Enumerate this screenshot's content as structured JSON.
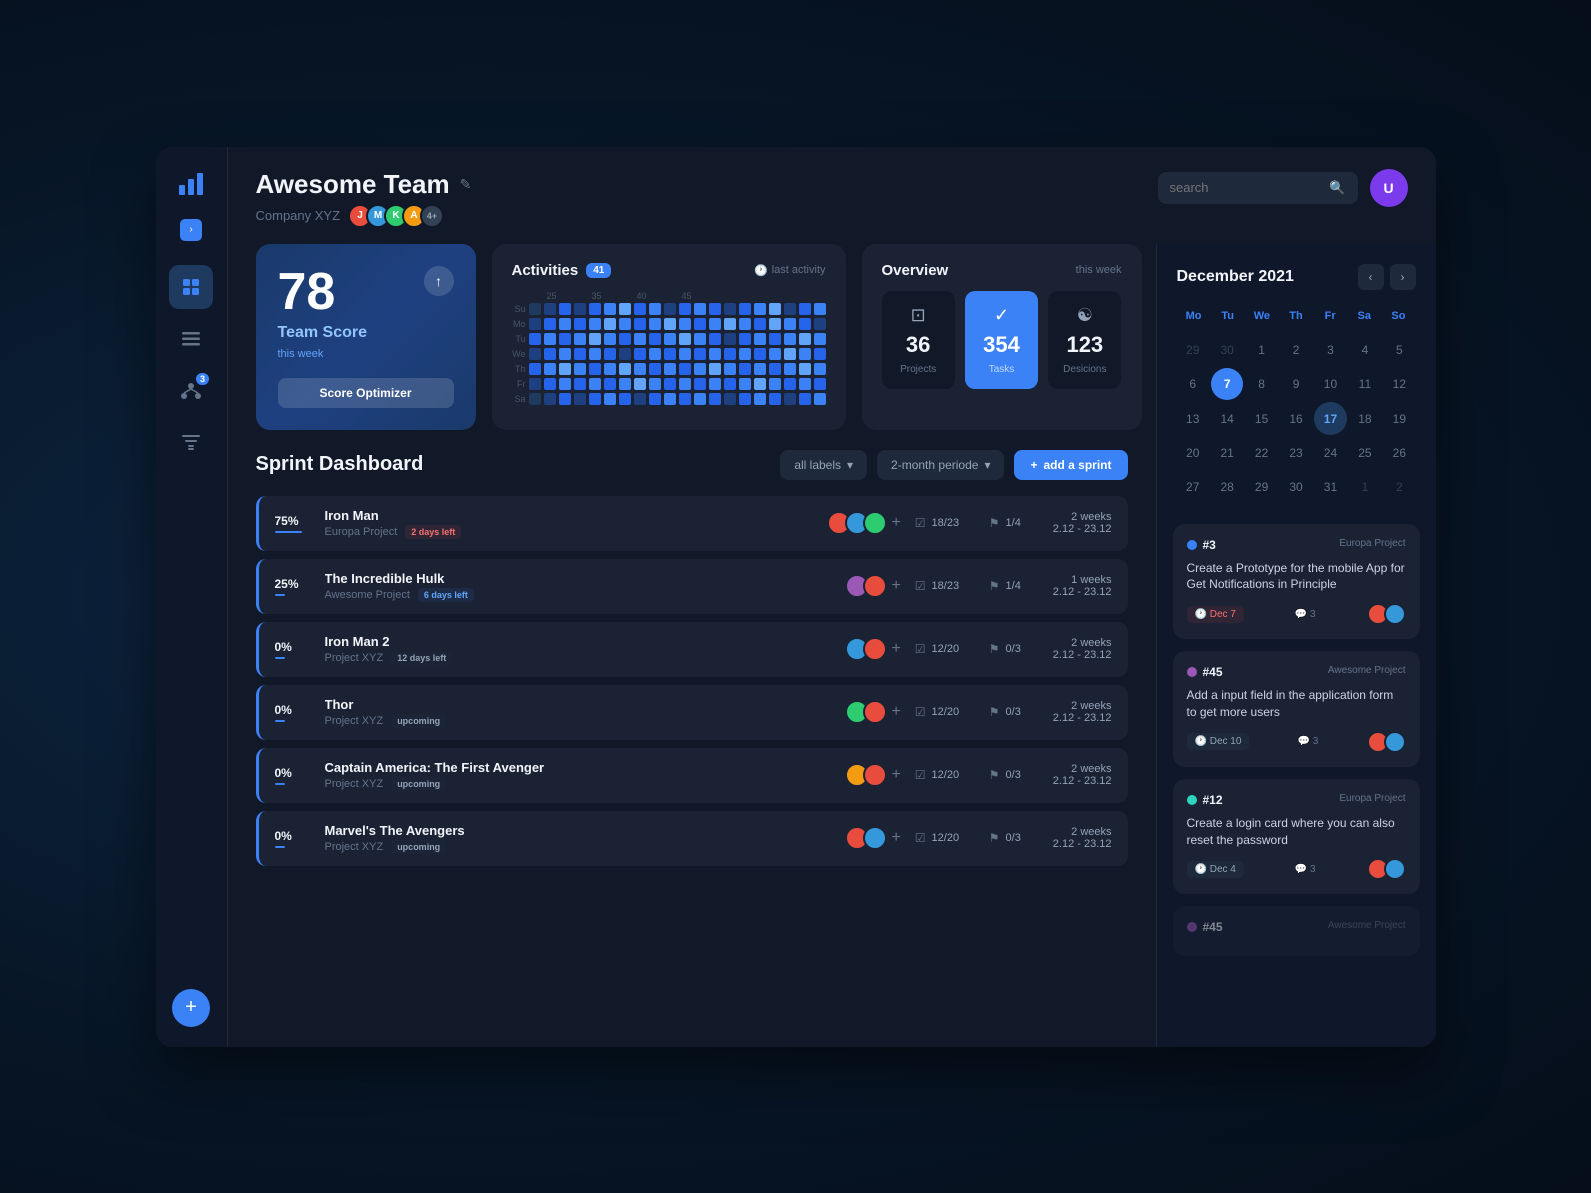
{
  "app": {
    "title": "Awesome Team",
    "company": "Company XYZ",
    "edit_icon": "✎"
  },
  "sidebar": {
    "items": [
      {
        "id": "dashboard",
        "icon": "⊞",
        "active": true,
        "badge": null
      },
      {
        "id": "list",
        "icon": "☰",
        "active": false,
        "badge": null
      },
      {
        "id": "org",
        "icon": "⋮⋮",
        "active": false,
        "badge": "3"
      },
      {
        "id": "filter",
        "icon": "⊟",
        "active": false,
        "badge": null
      }
    ],
    "fab_label": "+"
  },
  "header": {
    "search_placeholder": "search",
    "avatars": [
      "#e74c3c",
      "#3498db",
      "#2ecc71",
      "#f39c12"
    ],
    "avatar_count": "4+"
  },
  "score_card": {
    "number": "78",
    "label": "Team Score",
    "sublabel": "this week",
    "button": "Score Optimizer",
    "trend_icon": "↑"
  },
  "activities": {
    "title": "Activities",
    "count": "41",
    "subtitle": "last activity",
    "clock_icon": "🕐",
    "col_labels": [
      "25",
      "",
      "35",
      "",
      "40",
      "",
      "45",
      ""
    ],
    "row_labels": [
      "Su",
      "Mo",
      "Tu",
      "We",
      "Th",
      "Fr",
      "Sa"
    ],
    "heatmap": [
      [
        0,
        1,
        2,
        1,
        2,
        3,
        4,
        2,
        3,
        1,
        2,
        3,
        2,
        1,
        2,
        3,
        4,
        1,
        2,
        3
      ],
      [
        1,
        2,
        3,
        2,
        3,
        4,
        3,
        2,
        3,
        4,
        3,
        2,
        3,
        4,
        3,
        2,
        4,
        3,
        2,
        1
      ],
      [
        2,
        3,
        2,
        3,
        4,
        3,
        2,
        3,
        2,
        3,
        4,
        3,
        2,
        1,
        2,
        3,
        2,
        3,
        4,
        3
      ],
      [
        1,
        2,
        3,
        2,
        3,
        2,
        1,
        2,
        3,
        2,
        3,
        2,
        3,
        2,
        3,
        2,
        3,
        4,
        3,
        2
      ],
      [
        2,
        3,
        4,
        3,
        2,
        3,
        4,
        3,
        2,
        3,
        2,
        3,
        4,
        3,
        2,
        3,
        2,
        3,
        4,
        3
      ],
      [
        1,
        2,
        3,
        2,
        3,
        2,
        3,
        4,
        3,
        2,
        3,
        2,
        3,
        2,
        3,
        4,
        3,
        2,
        3,
        2
      ],
      [
        0,
        1,
        2,
        1,
        2,
        3,
        2,
        1,
        2,
        3,
        2,
        3,
        2,
        1,
        2,
        3,
        2,
        1,
        2,
        3
      ]
    ]
  },
  "overview": {
    "title": "Overview",
    "subtitle": "this week",
    "stats": [
      {
        "icon": "⊡",
        "number": "36",
        "label": "Projects"
      },
      {
        "icon": "✓",
        "number": "354",
        "label": "Tasks",
        "highlight": true
      },
      {
        "icon": "⊗",
        "number": "123",
        "label": "Decisions"
      }
    ]
  },
  "sprint": {
    "title": "Sprint Dashboard",
    "labels_btn": "all labels",
    "period_btn": "2-month periode",
    "add_btn": "add a sprint",
    "rows": [
      {
        "pct": "75%",
        "bar_width": "75",
        "name": "Iron Man",
        "project": "Europa Project",
        "tag": "2 days left",
        "tag_type": "red",
        "avatars": [
          "#e74c3c",
          "#3498db",
          "#2ecc71"
        ],
        "tasks": "18/23",
        "flags": "1/4",
        "duration": "2 weeks",
        "dates": "2.12 - 23.12"
      },
      {
        "pct": "25%",
        "bar_width": "25",
        "name": "The Incredible Hulk",
        "project": "Awesome Project",
        "tag": "6 days left",
        "tag_type": "blue",
        "avatars": [
          "#9b59b6",
          "#e74c3c"
        ],
        "tasks": "18/23",
        "flags": "1/4",
        "duration": "1 weeks",
        "dates": "2.12 - 23.12"
      },
      {
        "pct": "0%",
        "bar_width": "0",
        "name": "Iron Man 2",
        "project": "Project XYZ",
        "tag": "12 days left",
        "tag_type": "gray",
        "avatars": [
          "#3498db",
          "#e74c3c"
        ],
        "tasks": "12/20",
        "flags": "0/3",
        "duration": "2 weeks",
        "dates": "2.12 - 23.12"
      },
      {
        "pct": "0%",
        "bar_width": "0",
        "name": "Thor",
        "project": "Project XYZ",
        "tag": "upcoming",
        "tag_type": "gray",
        "avatars": [
          "#2ecc71",
          "#e74c3c"
        ],
        "tasks": "12/20",
        "flags": "0/3",
        "duration": "2 weeks",
        "dates": "2.12 - 23.12"
      },
      {
        "pct": "0%",
        "bar_width": "0",
        "name": "Captain America: The First Avenger",
        "project": "Project XYZ",
        "tag": "upcoming",
        "tag_type": "gray",
        "avatars": [
          "#f39c12",
          "#e74c3c"
        ],
        "tasks": "12/20",
        "flags": "0/3",
        "duration": "2 weeks",
        "dates": "2.12 - 23.12"
      },
      {
        "pct": "0%",
        "bar_width": "0",
        "name": "Marvel's The Avengers",
        "project": "Project XYZ",
        "tag": "upcoming",
        "tag_type": "gray",
        "avatars": [
          "#e74c3c",
          "#3498db"
        ],
        "tasks": "12/20",
        "flags": "0/3",
        "duration": "2 weeks",
        "dates": "2.12 - 23.12"
      }
    ]
  },
  "calendar": {
    "title": "December 2021",
    "day_names": [
      "Mo",
      "Tu",
      "We",
      "Th",
      "Fr",
      "Sa",
      "So"
    ],
    "weeks": [
      [
        {
          "n": "29",
          "m": "o"
        },
        {
          "n": "30",
          "m": "o"
        },
        {
          "n": "1"
        },
        {
          "n": "2"
        },
        {
          "n": "3"
        },
        {
          "n": "4"
        },
        {
          "n": "5"
        }
      ],
      [
        {
          "n": "6"
        },
        {
          "n": "7",
          "s": "today"
        },
        {
          "n": "8"
        },
        {
          "n": "9"
        },
        {
          "n": "10"
        },
        {
          "n": "11"
        },
        {
          "n": "12"
        }
      ],
      [
        {
          "n": "13"
        },
        {
          "n": "14"
        },
        {
          "n": "15"
        },
        {
          "n": "16"
        },
        {
          "n": "17",
          "s": "selected"
        },
        {
          "n": "18"
        },
        {
          "n": "19"
        }
      ],
      [
        {
          "n": "20"
        },
        {
          "n": "21"
        },
        {
          "n": "22"
        },
        {
          "n": "23"
        },
        {
          "n": "24"
        },
        {
          "n": "25"
        },
        {
          "n": "26"
        }
      ],
      [
        {
          "n": "27"
        },
        {
          "n": "28"
        },
        {
          "n": "29"
        },
        {
          "n": "30"
        },
        {
          "n": "31"
        },
        {
          "n": "1",
          "m": "o"
        },
        {
          "n": "2",
          "m": "o"
        }
      ]
    ]
  },
  "task_cards": [
    {
      "id": "#3",
      "dot_color": "#3b82f6",
      "project": "Europa Project",
      "desc": "Create a Prototype for the mobile App for Get Notifications in Principle",
      "date": "Dec 7",
      "date_type": "red",
      "comments": "3",
      "assignees": [
        "#e74c3c",
        "#3498db"
      ]
    },
    {
      "id": "#45",
      "dot_color": "#9b59b6",
      "project": "Awesome Project",
      "desc": "Add a input field in the application form to get more users",
      "date": "Dec 10",
      "date_type": "normal",
      "comments": "3",
      "assignees": [
        "#e74c3c",
        "#3498db"
      ]
    },
    {
      "id": "#12",
      "dot_color": "#2dd4bf",
      "project": "Europa Project",
      "desc": "Create a login card where you can also reset the password",
      "date": "Dec 4",
      "date_type": "normal",
      "comments": "3",
      "assignees": [
        "#e74c3c",
        "#3498db"
      ]
    },
    {
      "id": "#45",
      "dot_color": "#9b59b6",
      "project": "Awesome Project",
      "desc": "",
      "date": "",
      "date_type": "normal",
      "comments": "",
      "assignees": []
    }
  ]
}
